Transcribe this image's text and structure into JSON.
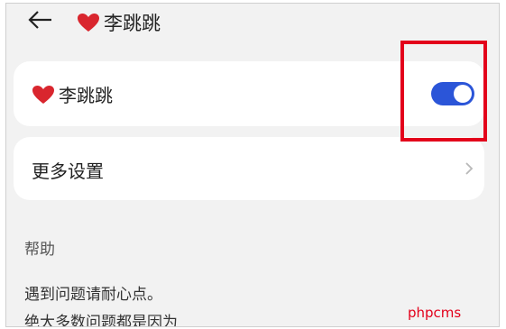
{
  "header": {
    "title": "李跳跳"
  },
  "settings": {
    "toggle_item": {
      "label": "李跳跳",
      "enabled": true
    },
    "more_item": {
      "label": "更多设置"
    }
  },
  "help": {
    "section_title": "帮助",
    "lines": [
      "遇到问题请耐心点。",
      "绝大多数问题都是因为"
    ]
  },
  "watermark": {
    "text": "phpcms"
  },
  "colors": {
    "toggle_on": "#2b55d8",
    "highlight": "#e3001b",
    "heart": "#d9262e",
    "background": "#f2f2f2"
  }
}
